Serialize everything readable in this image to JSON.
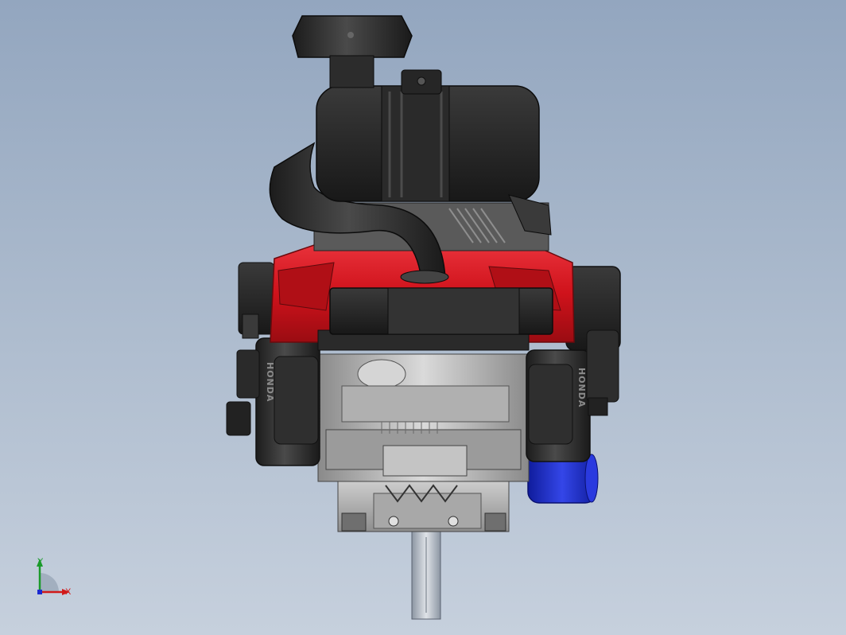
{
  "model": {
    "brand_text": "HONDA",
    "colors": {
      "shroud": "#d8141d",
      "shroud_dark": "#a10d14",
      "plastic": "#2b2b2b",
      "plastic_light": "#4a4a4a",
      "metal": "#b9b9b9",
      "metal_dark": "#7c7c7c",
      "oil_filter": "#1f2fd0",
      "background_top": "#93a6bf",
      "background_bottom": "#c6d0dd"
    }
  },
  "triad": {
    "x_label": "X",
    "y_label": "Y",
    "x_color": "#d11a1a",
    "y_color": "#1a9a2a",
    "z_color": "#1a2ad1"
  }
}
